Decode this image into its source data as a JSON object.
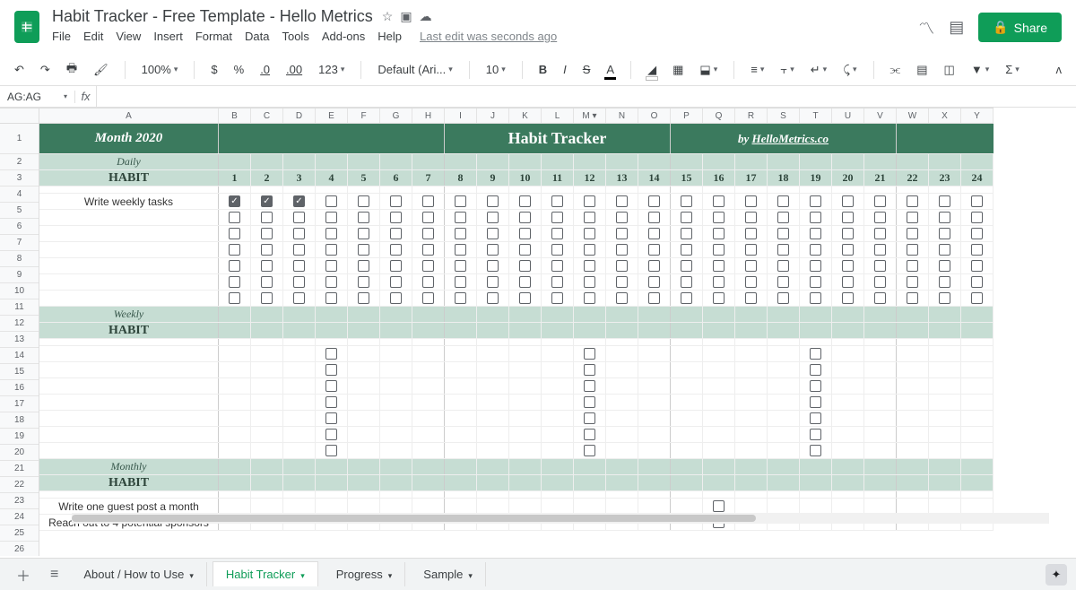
{
  "doc": {
    "title": "Habit Tracker - Free Template - Hello Metrics",
    "last_edit": "Last edit was seconds ago"
  },
  "menus": [
    "File",
    "Edit",
    "View",
    "Insert",
    "Format",
    "Data",
    "Tools",
    "Add-ons",
    "Help"
  ],
  "share_label": "Share",
  "toolbar": {
    "zoom": "100%",
    "currency": "$",
    "percent": "%",
    "dec_dec": ".0",
    "dec_inc": ".00",
    "more_formats": "123",
    "font": "Default (Ari...",
    "fontsize": "10",
    "bold": "B",
    "italic": "I",
    "strike": "S",
    "textcolor": "A",
    "sigma": "Σ"
  },
  "namebox": "AG:AG",
  "fx_label": "fx",
  "columns": [
    "A",
    "B",
    "C",
    "D",
    "E",
    "F",
    "G",
    "H",
    "I",
    "J",
    "K",
    "L",
    "M",
    "N",
    "O",
    "P",
    "Q",
    "R",
    "S",
    "T",
    "U",
    "V",
    "W",
    "X",
    "Y"
  ],
  "header": {
    "month": "Month 2020",
    "title": "Habit Tracker",
    "by_prefix": "by ",
    "by_link": "HelloMetrics.co"
  },
  "sections": {
    "daily_top": "Daily",
    "daily_bot": "HABIT",
    "weekly_top": "Weekly",
    "weekly_bot": "HABIT",
    "monthly_top": "Monthly",
    "monthly_bot": "HABIT"
  },
  "days": [
    "1",
    "2",
    "3",
    "4",
    "5",
    "6",
    "7",
    "8",
    "9",
    "10",
    "11",
    "12",
    "13",
    "14",
    "15",
    "16",
    "17",
    "18",
    "19",
    "20",
    "21",
    "22",
    "23",
    "24"
  ],
  "daily_rows": [
    {
      "task": "Write weekly tasks",
      "checks": [
        true,
        true,
        true,
        false,
        false,
        false,
        false,
        false,
        false,
        false,
        false,
        false,
        false,
        false,
        false,
        false,
        false,
        false,
        false,
        false,
        false,
        false,
        false,
        false
      ]
    },
    {
      "task": "",
      "checks": [
        false,
        false,
        false,
        false,
        false,
        false,
        false,
        false,
        false,
        false,
        false,
        false,
        false,
        false,
        false,
        false,
        false,
        false,
        false,
        false,
        false,
        false,
        false,
        false
      ]
    },
    {
      "task": "",
      "checks": [
        false,
        false,
        false,
        false,
        false,
        false,
        false,
        false,
        false,
        false,
        false,
        false,
        false,
        false,
        false,
        false,
        false,
        false,
        false,
        false,
        false,
        false,
        false,
        false
      ]
    },
    {
      "task": "",
      "checks": [
        false,
        false,
        false,
        false,
        false,
        false,
        false,
        false,
        false,
        false,
        false,
        false,
        false,
        false,
        false,
        false,
        false,
        false,
        false,
        false,
        false,
        false,
        false,
        false
      ]
    },
    {
      "task": "",
      "checks": [
        false,
        false,
        false,
        false,
        false,
        false,
        false,
        false,
        false,
        false,
        false,
        false,
        false,
        false,
        false,
        false,
        false,
        false,
        false,
        false,
        false,
        false,
        false,
        false
      ]
    },
    {
      "task": "",
      "checks": [
        false,
        false,
        false,
        false,
        false,
        false,
        false,
        false,
        false,
        false,
        false,
        false,
        false,
        false,
        false,
        false,
        false,
        false,
        false,
        false,
        false,
        false,
        false,
        false
      ]
    },
    {
      "task": "",
      "checks": [
        false,
        false,
        false,
        false,
        false,
        false,
        false,
        false,
        false,
        false,
        false,
        false,
        false,
        false,
        false,
        false,
        false,
        false,
        false,
        false,
        false,
        false,
        false,
        false
      ]
    }
  ],
  "weekly_rows": [
    {
      "cols": [
        3,
        11,
        18
      ]
    },
    {
      "cols": [
        3,
        11,
        18
      ]
    },
    {
      "cols": [
        3,
        11,
        18
      ]
    },
    {
      "cols": [
        3,
        11,
        18
      ]
    },
    {
      "cols": [
        3,
        11,
        18
      ]
    },
    {
      "cols": [
        3,
        11,
        18
      ]
    },
    {
      "cols": [
        3,
        11,
        18
      ]
    }
  ],
  "monthly_tasks": [
    "Write one guest post a month",
    "Reach out to 4 potential sponsors"
  ],
  "monthly_check_col": 15,
  "row_numbers": [
    "1",
    "2",
    "3",
    "4",
    "5",
    "6",
    "7",
    "8",
    "9",
    "10",
    "11",
    "12",
    "13",
    "14",
    "15",
    "16",
    "17",
    "18",
    "19",
    "20",
    "21",
    "22",
    "23",
    "24",
    "25",
    "26"
  ],
  "sheets": {
    "about": "About / How to Use",
    "habit": "Habit Tracker",
    "progress": "Progress",
    "sample": "Sample"
  }
}
